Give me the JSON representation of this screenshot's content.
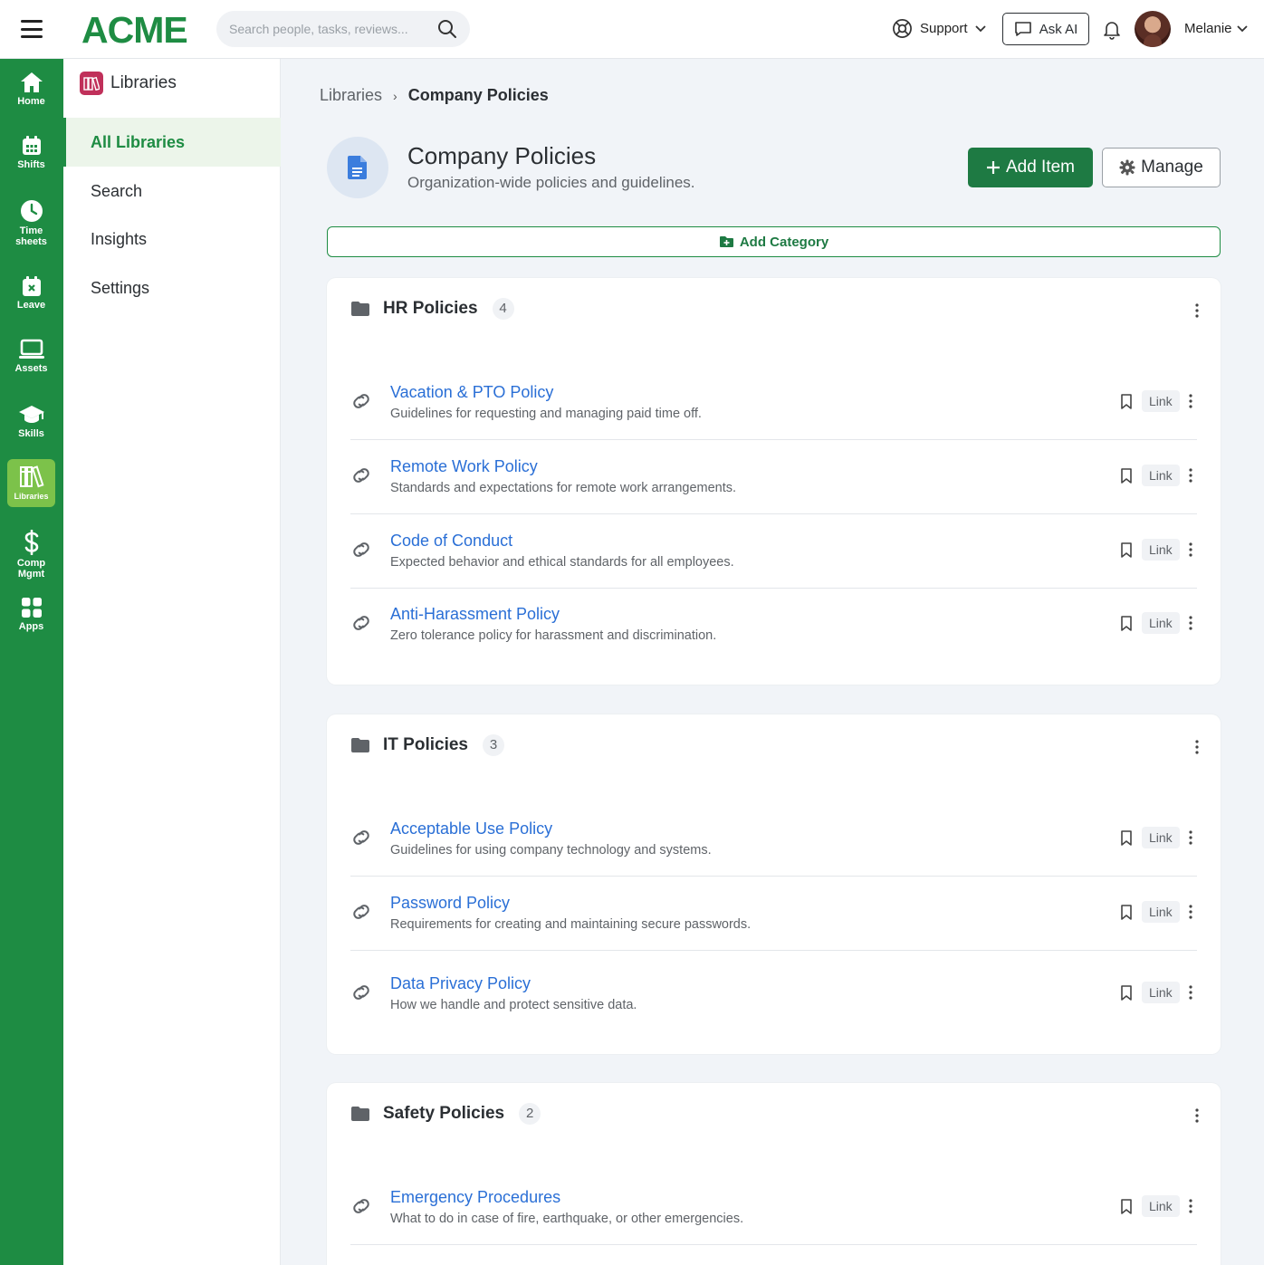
{
  "header": {
    "logo": "ACME",
    "search_placeholder": "Search people, tasks, reviews...",
    "support_label": "Support",
    "ask_ai_label": "Ask AI",
    "user_name": "Melanie"
  },
  "rail": [
    {
      "id": "home",
      "label": "Home",
      "icon": "home-icon"
    },
    {
      "id": "shifts",
      "label": "Shifts",
      "icon": "calendar-icon"
    },
    {
      "id": "timesheets",
      "label": "Time sheets",
      "icon": "clock-icon"
    },
    {
      "id": "leave",
      "label": "Leave",
      "icon": "leave-calendar-icon"
    },
    {
      "id": "assets",
      "label": "Assets",
      "icon": "laptop-icon"
    },
    {
      "id": "skills",
      "label": "Skills",
      "icon": "graduation-cap-icon"
    },
    {
      "id": "libraries",
      "label": "Libraries",
      "icon": "books-icon",
      "active": true
    },
    {
      "id": "comp",
      "label": "Comp Mgmt",
      "icon": "dollar-icon"
    },
    {
      "id": "apps",
      "label": "Apps",
      "icon": "grid-icon"
    }
  ],
  "subnav": {
    "title": "Libraries",
    "items": [
      {
        "label": "All Libraries",
        "active": true
      },
      {
        "label": "Search"
      },
      {
        "label": "Insights"
      },
      {
        "label": "Settings"
      }
    ]
  },
  "breadcrumb": {
    "root": "Libraries",
    "separator": "›",
    "current": "Company Policies"
  },
  "page": {
    "title": "Company Policies",
    "subtitle": "Organization-wide policies and guidelines.",
    "add_item_label": "Add Item",
    "manage_label": "Manage",
    "add_category_label": "Add Category"
  },
  "categories": [
    {
      "name": "HR Policies",
      "count": "4",
      "items": [
        {
          "title": "Vacation & PTO Policy",
          "desc": "Guidelines for requesting and managing paid time off.",
          "tag": "Link"
        },
        {
          "title": "Remote Work Policy",
          "desc": "Standards and expectations for remote work arrangements.",
          "tag": "Link"
        },
        {
          "title": "Code of Conduct",
          "desc": "Expected behavior and ethical standards for all employees.",
          "tag": "Link"
        },
        {
          "title": "Anti-Harassment Policy",
          "desc": "Zero tolerance policy for harassment and discrimination.",
          "tag": "Link"
        }
      ]
    },
    {
      "name": "IT Policies",
      "count": "3",
      "items": [
        {
          "title": "Acceptable Use Policy",
          "desc": "Guidelines for using company technology and systems.",
          "tag": "Link"
        },
        {
          "title": "Password Policy",
          "desc": "Requirements for creating and maintaining secure passwords.",
          "tag": "Link"
        },
        {
          "title": "Data Privacy Policy",
          "desc": "How we handle and protect sensitive data.",
          "tag": "Link"
        }
      ]
    },
    {
      "name": "Safety Policies",
      "count": "2",
      "items": [
        {
          "title": "Emergency Procedures",
          "desc": "What to do in case of fire, earthquake, or other emergencies.",
          "tag": "Link"
        }
      ]
    }
  ],
  "colors": {
    "brand_green": "#1e8c43",
    "active_rail": "#7cc24a",
    "link_blue": "#2a6fd6",
    "library_badge": "#c0305a"
  }
}
